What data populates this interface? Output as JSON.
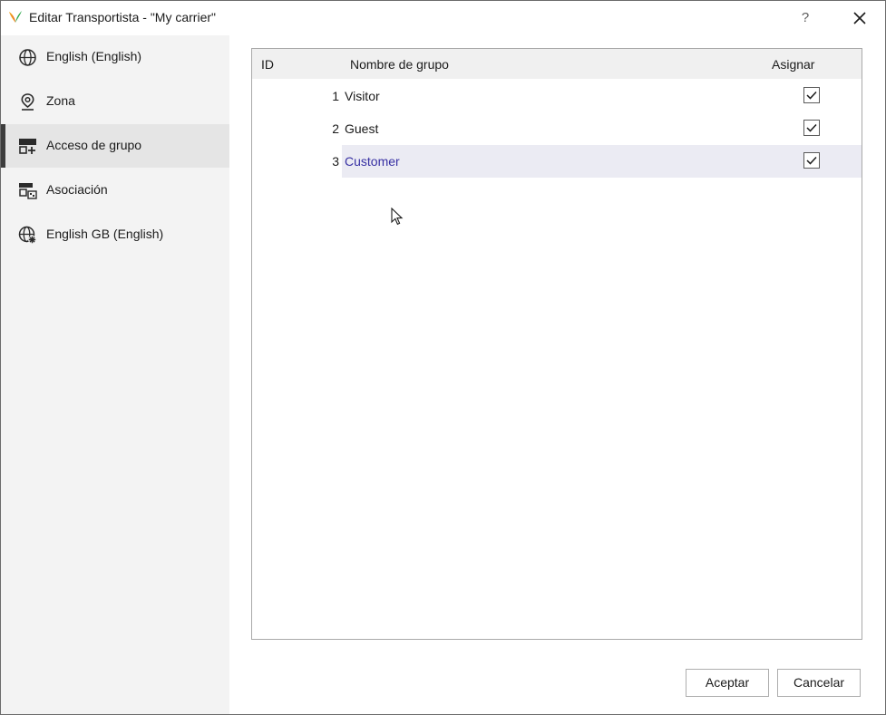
{
  "window": {
    "title": "Editar Transportista - \"My carrier\"",
    "help_label": "?"
  },
  "sidebar": {
    "items": [
      {
        "label": "English (English)",
        "icon": "globe-icon",
        "selected": false
      },
      {
        "label": "Zona",
        "icon": "location-pin-icon",
        "selected": false
      },
      {
        "label": "Acceso de grupo",
        "icon": "group-access-icon",
        "selected": true
      },
      {
        "label": "Asociación",
        "icon": "association-icon",
        "selected": false
      },
      {
        "label": "English GB (English)",
        "icon": "globe-settings-icon",
        "selected": false
      }
    ]
  },
  "grid": {
    "columns": {
      "id": "ID",
      "name": "Nombre de grupo",
      "assign": "Asignar"
    },
    "rows": [
      {
        "id": "1",
        "name": "Visitor",
        "assigned": true,
        "selected": false
      },
      {
        "id": "2",
        "name": "Guest",
        "assigned": true,
        "selected": false
      },
      {
        "id": "3",
        "name": "Customer",
        "assigned": true,
        "selected": true
      }
    ]
  },
  "buttons": {
    "accept": "Aceptar",
    "cancel": "Cancelar"
  },
  "colors": {
    "selected_text": "#3730a3",
    "sidebar_bg": "#f3f3f3",
    "selected_row_bg": "#ebebf3"
  }
}
